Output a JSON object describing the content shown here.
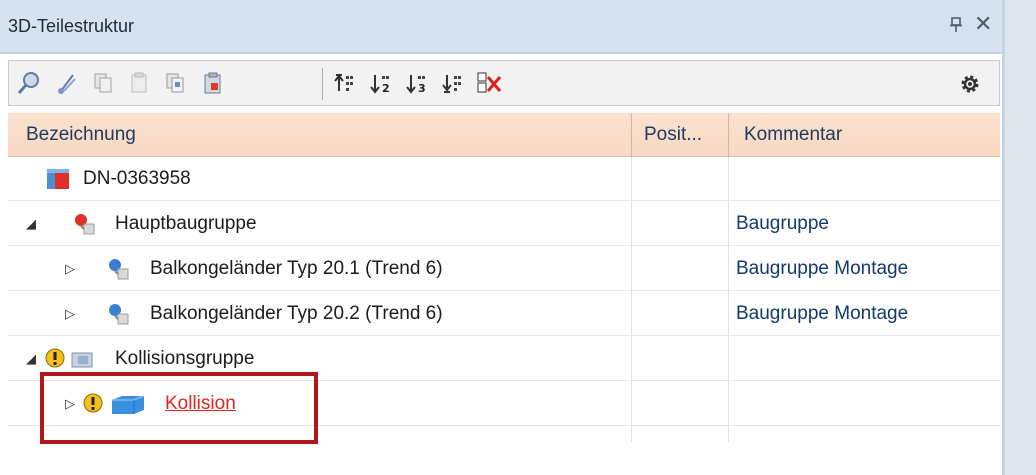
{
  "panel": {
    "title": "3D-Teilestruktur",
    "pin_glyph": "ᵖ",
    "close_glyph": "✕"
  },
  "toolbar": {
    "buttons": [
      {
        "name": "search-part-icon"
      },
      {
        "name": "cut-icon"
      },
      {
        "name": "copy-icon"
      },
      {
        "name": "paste-icon"
      },
      {
        "name": "copy-structure-icon"
      },
      {
        "name": "paste-structure-icon"
      },
      {
        "name": "sort-up-icon"
      },
      {
        "name": "sort-2-icon",
        "digit": "2"
      },
      {
        "name": "sort-3-icon",
        "digit": "3"
      },
      {
        "name": "sort-down-icon"
      },
      {
        "name": "clear-sort-icon"
      }
    ],
    "settings_icon": "gear-icon"
  },
  "grid": {
    "columns": [
      "Bezeichnung",
      "Posit...",
      "Kommentar"
    ],
    "rows": [
      {
        "level": 0,
        "expander": "",
        "label": "DN-0363958",
        "kommentar": "",
        "icon": "assembly-root-icon"
      },
      {
        "level": 0,
        "expander": "◢",
        "label": "Hauptbaugruppe",
        "kommentar": "Baugruppe",
        "icon": "assembly-red-icon"
      },
      {
        "level": 1,
        "expander": "▷",
        "label": "Balkongeländer Typ 20.1 (Trend 6)",
        "kommentar": "Baugruppe Montage",
        "icon": "assembly-blue-icon"
      },
      {
        "level": 1,
        "expander": "▷",
        "label": "Balkongeländer Typ 20.2 (Trend 6)",
        "kommentar": "Baugruppe Montage",
        "icon": "assembly-blue-icon"
      },
      {
        "level": 0,
        "expander": "◢",
        "label": "Kollisionsgruppe",
        "kommentar": "",
        "icon": "collision-group-icon"
      },
      {
        "level": 1,
        "expander": "▷",
        "label": "Kollision",
        "kommentar": "",
        "icon": "collision-icon",
        "link": true
      }
    ]
  },
  "colors": {
    "header_bg": "#f7d8c3",
    "link_red": "#e0261f",
    "highlight_border": "#b0161c"
  }
}
